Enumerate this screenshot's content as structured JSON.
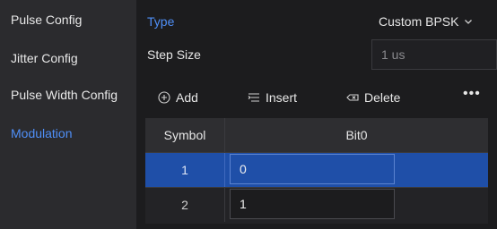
{
  "sidebar": {
    "items": [
      {
        "label": "Pulse Config"
      },
      {
        "label": "Jitter Config"
      },
      {
        "label": "Pulse Width Config"
      },
      {
        "label": "Modulation",
        "active": true
      }
    ]
  },
  "form": {
    "type_label": "Type",
    "type_value": "Custom BPSK",
    "step_label": "Step Size",
    "step_value": "1 us"
  },
  "toolbar": {
    "add_label": "Add",
    "insert_label": "Insert",
    "delete_label": "Delete",
    "more_label": "•••"
  },
  "table": {
    "columns": [
      "Symbol",
      "Bit0"
    ],
    "rows": [
      {
        "symbol": "1",
        "bit0": "0",
        "selected": true
      },
      {
        "symbol": "2",
        "bit0": "1",
        "selected": false
      }
    ]
  },
  "colors": {
    "accent": "#4f8ff7",
    "selected_row": "#1f4fa8",
    "sidebar_bg": "#2b2b2e",
    "main_bg": "#1c1c1e"
  }
}
